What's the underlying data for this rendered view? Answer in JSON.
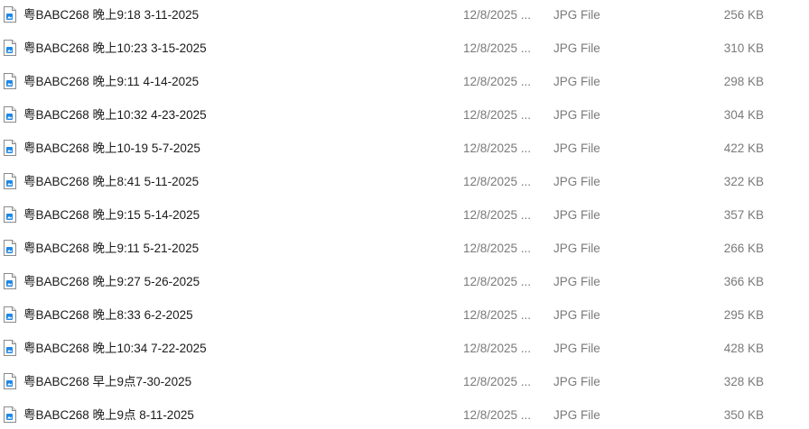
{
  "files": [
    {
      "name": "粤BABC268 晚上9:18 3-11-2025",
      "date": "12/8/2025 ...",
      "type": "JPG File",
      "size": "256 KB"
    },
    {
      "name": "粤BABC268 晚上10:23 3-15-2025",
      "date": "12/8/2025 ...",
      "type": "JPG File",
      "size": "310 KB"
    },
    {
      "name": "粤BABC268 晚上9:11 4-14-2025",
      "date": "12/8/2025 ...",
      "type": "JPG File",
      "size": "298 KB"
    },
    {
      "name": "粤BABC268 晚上10:32 4-23-2025",
      "date": "12/8/2025 ...",
      "type": "JPG File",
      "size": "304 KB"
    },
    {
      "name": "粤BABC268 晚上10-19 5-7-2025",
      "date": "12/8/2025 ...",
      "type": "JPG File",
      "size": "422 KB"
    },
    {
      "name": "粤BABC268 晚上8:41 5-11-2025",
      "date": "12/8/2025 ...",
      "type": "JPG File",
      "size": "322 KB"
    },
    {
      "name": "粤BABC268 晚上9:15 5-14-2025",
      "date": "12/8/2025 ...",
      "type": "JPG File",
      "size": "357 KB"
    },
    {
      "name": "粤BABC268 晚上9:11 5-21-2025",
      "date": "12/8/2025 ...",
      "type": "JPG File",
      "size": "266 KB"
    },
    {
      "name": "粤BABC268 晚上9:27 5-26-2025",
      "date": "12/8/2025 ...",
      "type": "JPG File",
      "size": "366 KB"
    },
    {
      "name": "粤BABC268 晚上8:33 6-2-2025",
      "date": "12/8/2025 ...",
      "type": "JPG File",
      "size": "295 KB"
    },
    {
      "name": "粤BABC268 晚上10:34 7-22-2025",
      "date": "12/8/2025 ...",
      "type": "JPG File",
      "size": "428 KB"
    },
    {
      "name": "粤BABC268 早上9点7-30-2025",
      "date": "12/8/2025 ...",
      "type": "JPG File",
      "size": "328 KB"
    },
    {
      "name": "粤BABC268 晚上9点 8-11-2025",
      "date": "12/8/2025 ...",
      "type": "JPG File",
      "size": "350 KB"
    }
  ],
  "icon": "jpg-file-icon",
  "colors": {
    "name_text": "#1a1a1a",
    "meta_text": "#7a7a7a",
    "icon_badge": "#1e88e5"
  }
}
